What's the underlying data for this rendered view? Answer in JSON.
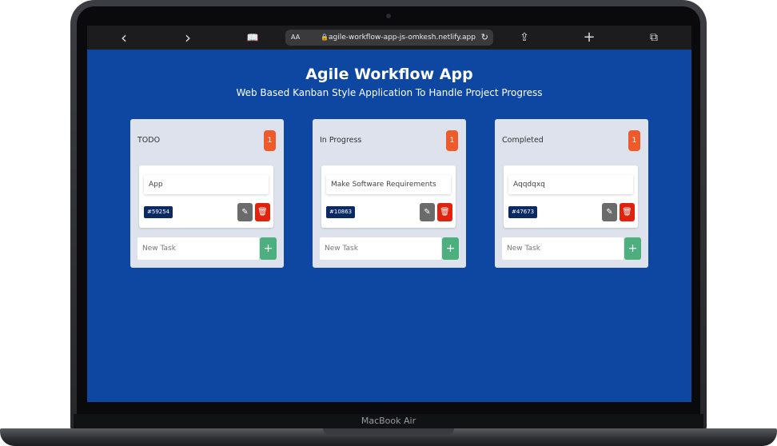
{
  "device": {
    "label": "MacBook Air"
  },
  "browser": {
    "back_icon": "‹",
    "forward_icon": "›",
    "bookmarks_icon": "📖",
    "aa_label": "AA",
    "lock_icon": "🔒",
    "url": "agile-workflow-app-js-omkesh.netlify.app",
    "reload_icon": "↻",
    "share_icon": "⇪",
    "new_tab_icon": "+",
    "tabs_icon": "⧉"
  },
  "app": {
    "title": "Agile Workflow App",
    "subtitle": "Web Based Kanban Style Application To Handle Project Progress",
    "accent_color": "#0d47a1"
  },
  "boards": [
    {
      "title": "TODO",
      "count": "1",
      "task": {
        "text": "App",
        "id": "#59254"
      },
      "new_task_placeholder": "New Task",
      "edit_icon": "✎",
      "delete_icon": "🗑",
      "add_label": "+"
    },
    {
      "title": "In Progress",
      "count": "1",
      "task": {
        "text": "Make Software Requirements",
        "id": "#10863"
      },
      "new_task_placeholder": "New Task",
      "edit_icon": "✎",
      "delete_icon": "🗑",
      "add_label": "+"
    },
    {
      "title": "Completed",
      "count": "1",
      "task": {
        "text": "Aqqdqxq",
        "id": "#47673"
      },
      "new_task_placeholder": "New Task",
      "edit_icon": "✎",
      "delete_icon": "🗑",
      "add_label": "+"
    }
  ]
}
